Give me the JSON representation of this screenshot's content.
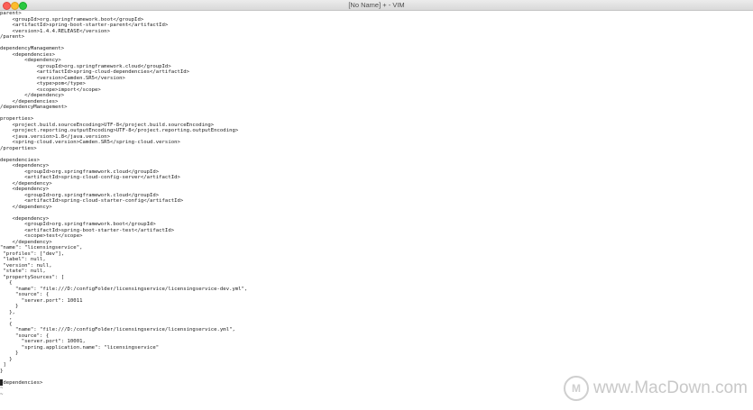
{
  "window": {
    "title": "[No Name] + - VIM"
  },
  "editor": {
    "lines": [
      "parent>",
      "    <groupId>org.springframework.boot</groupId>",
      "    <artifactId>spring-boot-starter-parent</artifactId>",
      "    <version>1.4.4.RELEASE</version>",
      "/parent>",
      "",
      "dependencyManagement>",
      "    <dependencies>",
      "        <dependency>",
      "            <groupId>org.springframework.cloud</groupId>",
      "            <artifactId>spring-cloud-dependencies</artifactId>",
      "            <version>Camden.SR5</version>",
      "            <type>pom</type>",
      "            <scope>import</scope>",
      "        </dependency>",
      "    </dependencies>",
      "/dependencyManagement>",
      "",
      "properties>",
      "    <project.build.sourceEncoding>UTF-8</project.build.sourceEncoding>",
      "    <project.reporting.outputEncoding>UTF-8</project.reporting.outputEncoding>",
      "    <java.version>1.8</java.version>",
      "    <spring-cloud.version>Camden.SR5</spring-cloud.version>",
      "/properties>",
      "",
      "dependencies>",
      "    <dependency>",
      "        <groupId>org.springframework.cloud</groupId>",
      "        <artifactId>spring-cloud-config-server</artifactId>",
      "    </dependency>",
      "    <dependency>",
      "        <groupId>org.springframework.cloud</groupId>",
      "        <artifactId>spring-cloud-starter-config</artifactId>",
      "    </dependency>",
      "",
      "    <dependency>",
      "        <groupId>org.springframework.boot</groupId>",
      "        <artifactId>spring-boot-starter-test</artifactId>",
      "        <scope>test</scope>",
      "    </dependency>",
      "\"name\": \"licensingservice\",",
      " \"profiles\": [\"dev\"],",
      " \"label\": null,",
      " \"version\": null,",
      " \"state\": null,",
      " \"propertySources\": [",
      "   {",
      "     \"name\": \"file:///D:/configFolder/licensingservice/licensingservice-dev.yml\",",
      "     \"source\": {",
      "       \"server.port\": 10011",
      "     }",
      "   },",
      "   ,",
      "   {",
      "     \"name\": \"file:///D:/configFolder/licensingservice/licensingservice.yml\",",
      "     \"source\": {",
      "       \"server.port\": 10001,",
      "       \"spring.application.name\": \"licensingservice\"",
      "     }",
      "   }",
      " ]",
      "}",
      "",
      "/dependencies>",
      "~",
      "~"
    ]
  },
  "watermark": {
    "text": "www.MacDown.com"
  }
}
